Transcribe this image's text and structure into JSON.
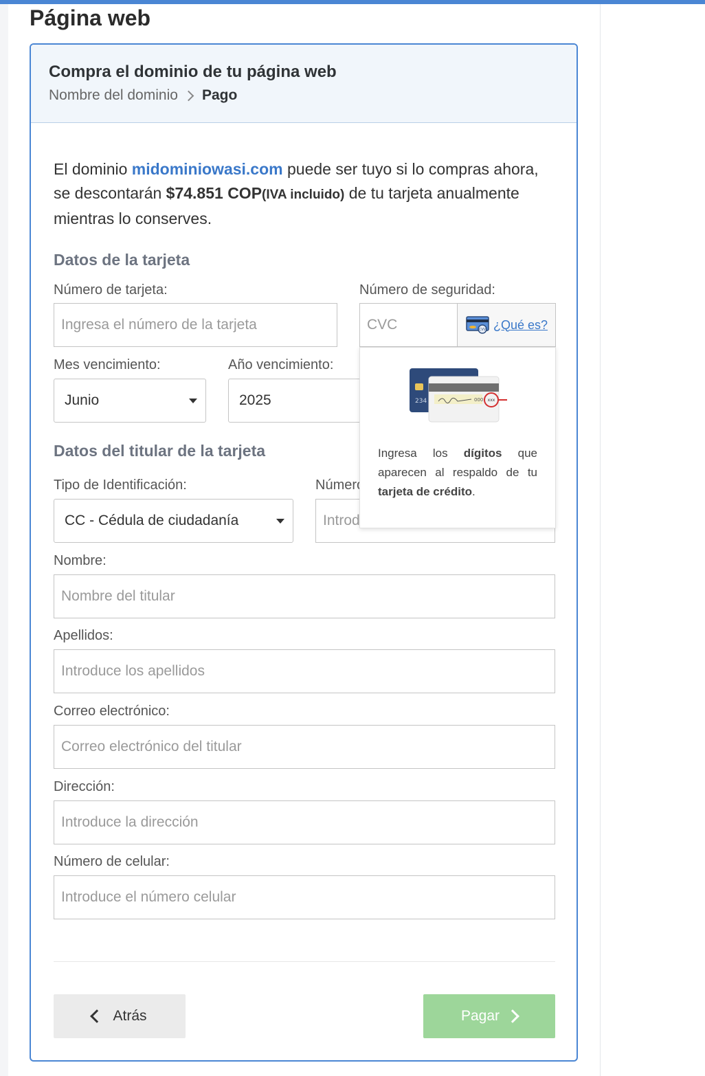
{
  "page": {
    "title": "Página web"
  },
  "card": {
    "title": "Compra el dominio de tu página web",
    "breadcrumb": {
      "step1": "Nombre del dominio",
      "step2": "Pago"
    }
  },
  "intro": {
    "part1": "El dominio ",
    "domain": "midominiowasi.com",
    "part2": " puede ser tuyo si lo compras ahora, se descontarán ",
    "price": "$74.851 COP",
    "iva": "(IVA incluido)",
    "part3": " de tu tarjeta anualmente mientras lo conserves."
  },
  "card_section": {
    "title": "Datos de la tarjeta",
    "card_number_label": "Número de tarjeta:",
    "card_number_placeholder": "Ingresa el número de la tarjeta",
    "security_label": "Número de seguridad:",
    "cvc_placeholder": "CVC",
    "cvc_help_link": "¿Qué es?",
    "month_label": "Mes vencimiento:",
    "month_value": "Junio",
    "year_label": "Año vencimiento:",
    "year_value": "2025"
  },
  "cvc_popover": {
    "t1": "Ingresa los ",
    "b1": "dígitos",
    "t2": " que aparecen al respaldo de tu ",
    "b2": "tarjeta de crédito",
    "t3": ".",
    "card_digits": "234",
    "back_digits": "000",
    "cvv_mark": "xxx"
  },
  "holder_section": {
    "title": "Datos del titular de la tarjeta",
    "id_type_label": "Tipo de Identificación:",
    "id_type_value": "CC - Cédula de ciudadanía",
    "id_number_label": "Número",
    "id_number_placeholder": "Introd",
    "name_label": "Nombre:",
    "name_placeholder": "Nombre del titular",
    "lastname_label": "Apellidos:",
    "lastname_placeholder": "Introduce los apellidos",
    "email_label": "Correo electrónico:",
    "email_placeholder": "Correo electrónico del titular",
    "address_label": "Dirección:",
    "address_placeholder": "Introduce la dirección",
    "phone_label": "Número de celular:",
    "phone_placeholder": "Introduce el número celular"
  },
  "actions": {
    "back": "Atrás",
    "pay": "Pagar"
  },
  "colors": {
    "accent": "#4a86d4",
    "link": "#3a78c9",
    "pay_disabled": "#9dd69a"
  }
}
